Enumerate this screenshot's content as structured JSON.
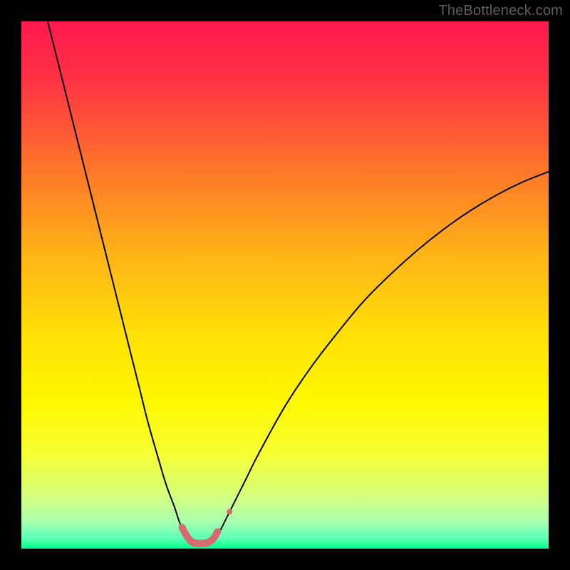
{
  "watermark": "TheBottleneck.com",
  "chart_data": {
    "type": "line",
    "title": "",
    "xlabel": "",
    "ylabel": "",
    "xlim": [
      0,
      100
    ],
    "ylim": [
      0,
      100
    ],
    "background": {
      "kind": "vertical-gradient",
      "stops": [
        {
          "pos": 0.0,
          "color": "#ff1a4d"
        },
        {
          "pos": 0.1,
          "color": "#ff2f45"
        },
        {
          "pos": 0.25,
          "color": "#ff6a2e"
        },
        {
          "pos": 0.45,
          "color": "#ffb616"
        },
        {
          "pos": 0.6,
          "color": "#ffe205"
        },
        {
          "pos": 0.72,
          "color": "#fff700"
        },
        {
          "pos": 0.82,
          "color": "#f5ff33"
        },
        {
          "pos": 0.9,
          "color": "#d6ff7e"
        },
        {
          "pos": 0.95,
          "color": "#a6ffb0"
        },
        {
          "pos": 0.98,
          "color": "#5fffb8"
        },
        {
          "pos": 1.0,
          "color": "#00ff88"
        }
      ]
    },
    "series": [
      {
        "name": "left-branch",
        "color": "#000000",
        "width": 2,
        "x": [
          5.0,
          7.5,
          10.0,
          12.5,
          15.0,
          17.5,
          20.0,
          22.5,
          24.0,
          26.0,
          27.5,
          29.0,
          30.0,
          31.0,
          31.8
        ],
        "y": [
          100.0,
          90.0,
          80.0,
          70.0,
          60.0,
          50.0,
          40.0,
          30.0,
          24.0,
          17.0,
          12.0,
          8.0,
          5.0,
          3.0,
          2.0
        ]
      },
      {
        "name": "right-branch",
        "color": "#000000",
        "width": 2,
        "x": [
          37.0,
          38.0,
          40.0,
          42.5,
          45.0,
          50.0,
          55.0,
          60.0,
          65.0,
          70.0,
          75.0,
          80.0,
          85.0,
          90.0,
          95.0,
          100.0
        ],
        "y": [
          2.0,
          4.0,
          8.0,
          13.0,
          18.0,
          27.0,
          34.5,
          41.0,
          47.0,
          52.0,
          56.5,
          60.5,
          64.0,
          67.0,
          69.5,
          71.5
        ]
      },
      {
        "name": "valley-highlight",
        "color": "#d66a6d",
        "width": 10,
        "linecap": "round",
        "x": [
          30.5,
          31.5,
          32.5,
          33.5,
          34.5,
          35.5,
          36.5,
          37.2
        ],
        "y": [
          4.0,
          2.2,
          1.2,
          1.0,
          1.0,
          1.2,
          2.0,
          3.2
        ]
      }
    ],
    "markers": [
      {
        "name": "dot-right",
        "x": 39.5,
        "y": 7.0,
        "r": 4,
        "color": "#d66a6d"
      }
    ]
  }
}
